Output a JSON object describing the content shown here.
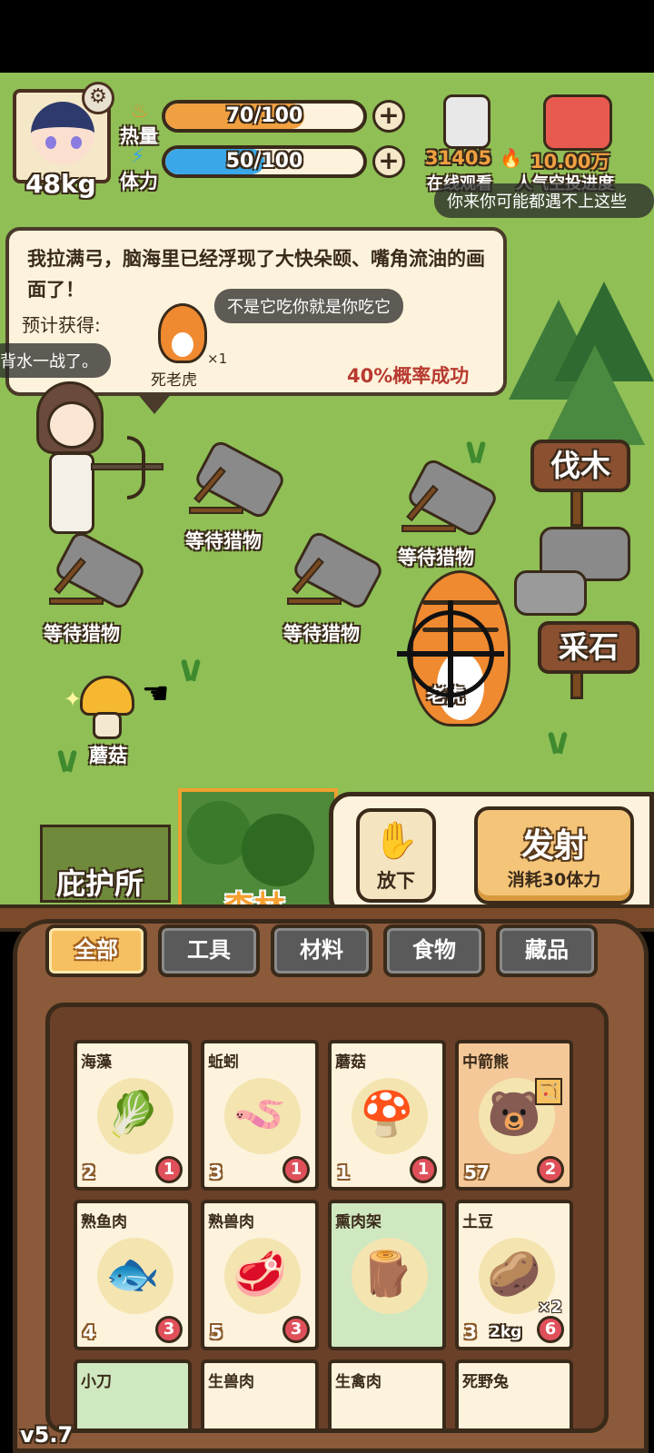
{
  "player": {
    "weight": "48kg"
  },
  "stats": {
    "heat": {
      "label": "热量",
      "value_text": "70/100",
      "fraction": 0.7,
      "color": "#f0a040"
    },
    "stamina": {
      "label": "体力",
      "value_text": "50/100",
      "fraction": 0.5,
      "color": "#3aa8e8"
    }
  },
  "live": {
    "viewers": "31405",
    "viewers_label": "在线观看",
    "popularity": "10.00万",
    "popularity_label": "人气空投进度"
  },
  "danmaku": [
    "你来你可能都遇不上这些",
    "不是它吃你就是你吃它",
    "背水一战了。"
  ],
  "dialog": {
    "text": "我拉满弓，脑海里已经浮现了大快朵颐、嘴角流油的画面了！",
    "expected_label": "预计获得:",
    "reward_name": "死老虎",
    "reward_qty": "×1",
    "chance": "40%概率成功"
  },
  "scene": {
    "traps": [
      "等待猎物",
      "等待猎物",
      "等待猎物",
      "等待猎物"
    ],
    "mushroom_label": "蘑菇",
    "tiger_label": "老虎",
    "sign_wood": "伐木",
    "sign_stone": "采石"
  },
  "locations": {
    "shelter": "庇护所",
    "forest": "森林"
  },
  "actions": {
    "drop": "放下",
    "fire": "发射",
    "fire_cost": "消耗30体力"
  },
  "tabs": [
    "全部",
    "工具",
    "材料",
    "食物",
    "藏品"
  ],
  "active_tab": "全部",
  "inventory": [
    {
      "name": "海藻",
      "icon": "🥬",
      "level": "2",
      "count": "1",
      "style": "normal"
    },
    {
      "name": "蚯蚓",
      "icon": "🪱",
      "level": "3",
      "count": "1",
      "style": "normal"
    },
    {
      "name": "蘑菇",
      "icon": "🍄",
      "level": "1",
      "count": "1",
      "style": "normal"
    },
    {
      "name": "中箭熊",
      "icon": "🐻",
      "level": "57",
      "count": "2",
      "style": "orange",
      "tag": "🏹"
    },
    {
      "name": "熟鱼肉",
      "icon": "🐟",
      "level": "4",
      "count": "3",
      "style": "normal"
    },
    {
      "name": "熟兽肉",
      "icon": "🥩",
      "level": "5",
      "count": "3",
      "style": "normal"
    },
    {
      "name": "熏肉架",
      "icon": "🪵",
      "level": "",
      "count": "",
      "style": "green"
    },
    {
      "name": "土豆",
      "icon": "🥔",
      "level": "3",
      "count": "6",
      "style": "normal",
      "weight": "2kg",
      "multiplier": "×2"
    },
    {
      "name": "小刀",
      "icon": "",
      "level": "",
      "count": "",
      "style": "green"
    },
    {
      "name": "生兽肉",
      "icon": "",
      "level": "",
      "count": "",
      "style": "normal"
    },
    {
      "name": "生禽肉",
      "icon": "",
      "level": "",
      "count": "",
      "style": "normal"
    },
    {
      "name": "死野兔",
      "icon": "",
      "level": "",
      "count": "",
      "style": "normal"
    }
  ],
  "version": "v5.7"
}
